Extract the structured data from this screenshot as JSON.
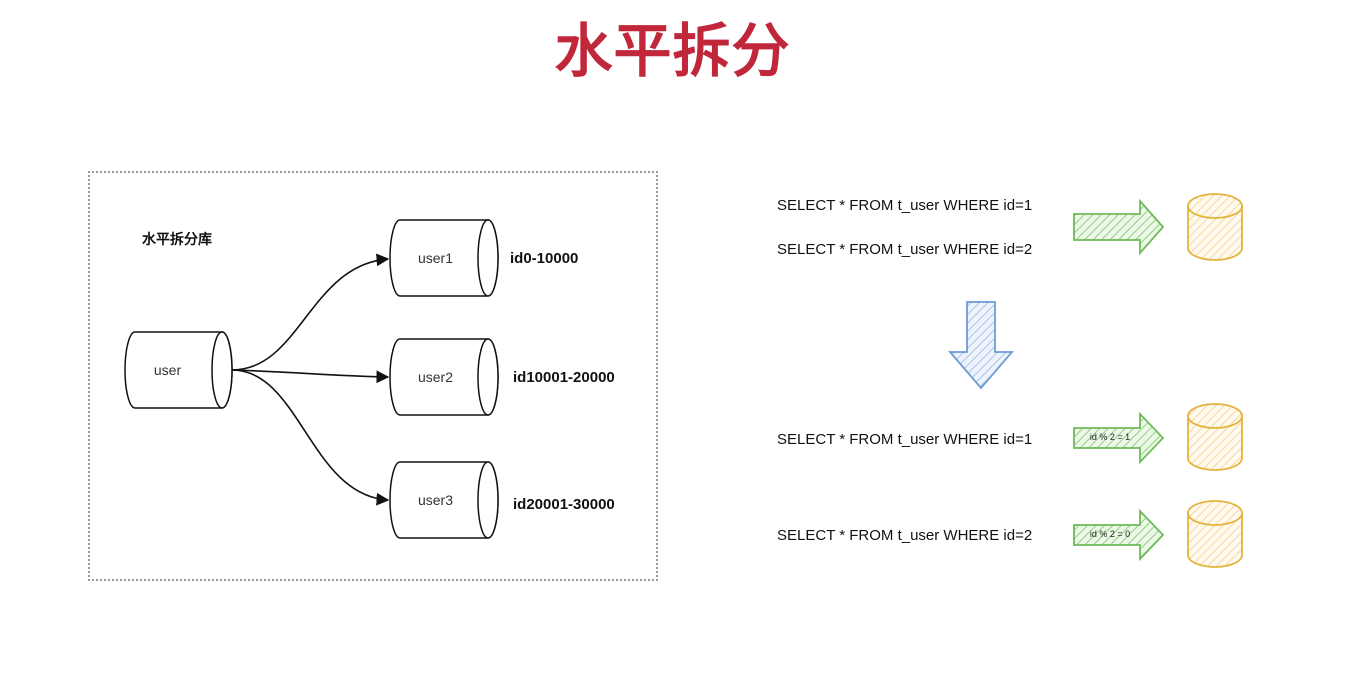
{
  "page_title": "水平拆分",
  "colors": {
    "title": "#c0273a",
    "green_arrow": "#7cc36a",
    "blue_arrow": "#7fa7d8",
    "db_orange": "#e4b33c"
  },
  "left_diagram": {
    "group_label": "水平拆分库",
    "source_db": "user",
    "shards": [
      {
        "name": "user1",
        "range": "id0-10000"
      },
      {
        "name": "user2",
        "range": "id10001-20000"
      },
      {
        "name": "user3",
        "range": "id20001-30000"
      }
    ]
  },
  "right_diagram": {
    "before_queries": [
      "SELECT * FROM t_user WHERE id=1",
      "SELECT * FROM t_user WHERE id=2"
    ],
    "after": [
      {
        "query": "SELECT * FROM t_user WHERE id=1",
        "rule": "id % 2 = 1"
      },
      {
        "query": "SELECT * FROM t_user WHERE id=2",
        "rule": "id % 2 = 0"
      }
    ]
  }
}
